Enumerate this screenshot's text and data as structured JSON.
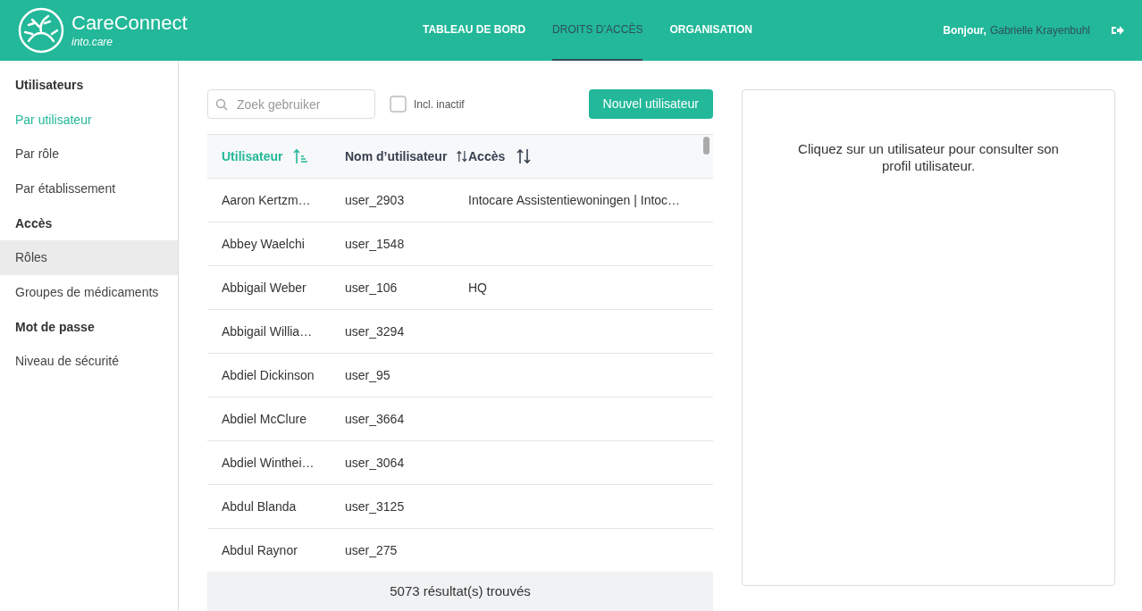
{
  "brand": {
    "name": "CareConnect",
    "tagline": "into.care"
  },
  "nav": [
    {
      "label": "TABLEAU DE BORD",
      "selected": false
    },
    {
      "label": "DROITS D’ACCÈS",
      "selected": true
    },
    {
      "label": "ORGANISATION",
      "selected": false
    }
  ],
  "greeting": {
    "label": "Bonjour,",
    "user": "Gabrielle Krayenbuhl"
  },
  "sidebar": {
    "items": [
      {
        "kind": "heading",
        "label": "Utilisateurs",
        "selected": false,
        "hovered": false
      },
      {
        "kind": "link",
        "label": "Par utilisateur",
        "selected": true,
        "hovered": false
      },
      {
        "kind": "link",
        "label": "Par rôle",
        "selected": false,
        "hovered": false
      },
      {
        "kind": "link",
        "label": "Par établissement",
        "selected": false,
        "hovered": false
      },
      {
        "kind": "heading",
        "label": "Accès",
        "selected": false,
        "hovered": false
      },
      {
        "kind": "link",
        "label": "Rôles",
        "selected": false,
        "hovered": true
      },
      {
        "kind": "link",
        "label": "Groupes de médicaments",
        "selected": false,
        "hovered": false
      },
      {
        "kind": "heading",
        "label": "Mot de passe",
        "selected": false,
        "hovered": false
      },
      {
        "kind": "link",
        "label": "Niveau de sécurité",
        "selected": false,
        "hovered": false
      }
    ]
  },
  "search": {
    "placeholder": "Zoek gebruiker"
  },
  "include_inactive": {
    "label": "Incl. inactif",
    "checked": false
  },
  "new_user_button": "Nouvel utilisateur",
  "table": {
    "columns": [
      {
        "label": "Utilisateur",
        "sorted": true
      },
      {
        "label": "Nom d’utilisateur",
        "sorted": false
      },
      {
        "label": "Accès",
        "sorted": false
      }
    ],
    "rows": [
      [
        "Aaron Kertzm…",
        "user_2903",
        "Intocare Assistentiewoningen | Intoc…"
      ],
      [
        "Abbey Waelchi",
        "user_1548",
        ""
      ],
      [
        "Abbigail Weber",
        "user_106",
        "HQ"
      ],
      [
        "Abbigail Willia…",
        "user_3294",
        ""
      ],
      [
        "Abdiel Dickinson",
        "user_95",
        ""
      ],
      [
        "Abdiel McClure",
        "user_3664",
        ""
      ],
      [
        "Abdiel Winthei…",
        "user_3064",
        ""
      ],
      [
        "Abdul Blanda",
        "user_3125",
        ""
      ],
      [
        "Abdul Raynor",
        "user_275",
        ""
      ]
    ],
    "result_count": "5073 résultat(s) trouvés"
  },
  "detail_panel": {
    "message": "Cliquez sur un utilisateur pour consulter son profil utilisateur."
  }
}
